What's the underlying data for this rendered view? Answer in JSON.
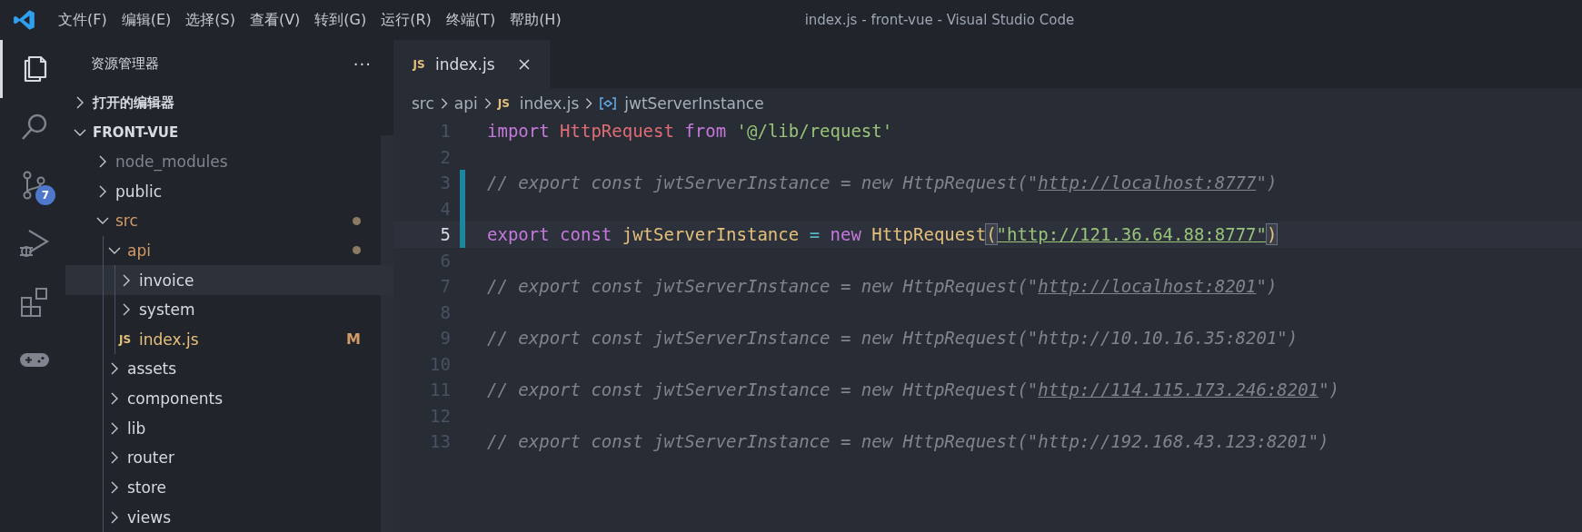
{
  "window": {
    "title": "index.js - front-vue - Visual Studio Code"
  },
  "menu": [
    "文件(F)",
    "编辑(E)",
    "选择(S)",
    "查看(V)",
    "转到(G)",
    "运行(R)",
    "终端(T)",
    "帮助(H)"
  ],
  "activity_bar": [
    {
      "selected": true
    },
    {
      "selected": false
    },
    {
      "selected": false,
      "badge": "7"
    },
    {
      "selected": false
    },
    {
      "selected": false
    },
    {
      "selected": false
    }
  ],
  "sidebar": {
    "title": "资源管理器",
    "more": "···",
    "sections": [
      {
        "label": "打开的编辑器",
        "expanded": false
      },
      {
        "label": "FRONT-VUE",
        "expanded": true
      }
    ],
    "tree": [
      {
        "kind": "folder",
        "label": "node_modules",
        "expanded": false,
        "selected": false,
        "modified": false,
        "ignored": true
      },
      {
        "kind": "folder",
        "label": "public",
        "expanded": false,
        "selected": false,
        "modified": false,
        "ignored": false
      },
      {
        "kind": "folder",
        "label": "src",
        "expanded": true,
        "selected": false,
        "modified": true,
        "ignored": false,
        "children": [
          {
            "kind": "folder",
            "label": "api",
            "expanded": true,
            "selected": false,
            "modified": true,
            "ignored": false,
            "children": [
              {
                "kind": "folder",
                "label": "invoice",
                "expanded": false,
                "selected": true,
                "modified": false,
                "ignored": false
              },
              {
                "kind": "folder",
                "label": "system",
                "expanded": false,
                "selected": false,
                "modified": false,
                "ignored": false
              },
              {
                "kind": "file",
                "icon": "JS",
                "label": "index.js",
                "badge": "M",
                "selected": false,
                "modified": true,
                "ignored": false
              }
            ]
          },
          {
            "kind": "folder",
            "label": "assets",
            "expanded": false,
            "selected": false,
            "modified": false,
            "ignored": false
          },
          {
            "kind": "folder",
            "label": "components",
            "expanded": false,
            "selected": false,
            "modified": false,
            "ignored": false
          },
          {
            "kind": "folder",
            "label": "lib",
            "expanded": false,
            "selected": false,
            "modified": false,
            "ignored": false
          },
          {
            "kind": "folder",
            "label": "router",
            "expanded": false,
            "selected": false,
            "modified": false,
            "ignored": false
          },
          {
            "kind": "folder",
            "label": "store",
            "expanded": false,
            "selected": false,
            "modified": false,
            "ignored": false
          },
          {
            "kind": "folder",
            "label": "views",
            "expanded": false,
            "selected": false,
            "modified": false,
            "ignored": false
          }
        ]
      }
    ]
  },
  "tabs": [
    {
      "icon": "JS",
      "label": "index.js",
      "selected": true
    }
  ],
  "breadcrumbs": [
    {
      "kind": "folder",
      "label": "src"
    },
    {
      "kind": "folder",
      "label": "api"
    },
    {
      "kind": "file",
      "icon": "JS",
      "label": "index.js"
    },
    {
      "kind": "symbol",
      "label": "jwtServerInstance"
    }
  ],
  "lines": [
    {
      "number": "1",
      "current": false,
      "changed": false,
      "tokens": [
        {
          "kind": "keyword",
          "text": "import "
        },
        {
          "kind": "class",
          "text": "HttpRequest "
        },
        {
          "kind": "keyword",
          "text": "from "
        },
        {
          "kind": "string",
          "text": "'@/lib/request'"
        }
      ]
    },
    {
      "number": "2",
      "current": false,
      "changed": false
    },
    {
      "number": "3",
      "current": false,
      "changed": true,
      "tokens": [
        {
          "kind": "comment",
          "text": "// export const jwtServerInstance = new HttpRequest(\""
        },
        {
          "kind": "comment-link",
          "text": "http://localhost:8777"
        },
        {
          "kind": "comment",
          "text": "\")"
        }
      ]
    },
    {
      "number": "4",
      "current": false,
      "changed": true
    },
    {
      "number": "5",
      "current": true,
      "changed": true,
      "tokens": [
        {
          "kind": "keyword",
          "text": "export const "
        },
        {
          "kind": "variable",
          "text": "jwtServerInstance "
        },
        {
          "kind": "operator",
          "text": "= "
        },
        {
          "kind": "keyword",
          "text": "new "
        },
        {
          "kind": "variable",
          "text": "HttpRequest"
        },
        {
          "kind": "bracket-match",
          "text": "("
        },
        {
          "kind": "string-link",
          "text": "\"http://121.36.64.88:8777\""
        },
        {
          "kind": "bracket-match",
          "text": ")"
        }
      ]
    },
    {
      "number": "6",
      "current": false,
      "changed": false
    },
    {
      "number": "7",
      "current": false,
      "changed": false,
      "tokens": [
        {
          "kind": "comment",
          "text": "// export const jwtServerInstance = new HttpRequest(\""
        },
        {
          "kind": "comment-link",
          "text": "http://localhost:8201"
        },
        {
          "kind": "comment",
          "text": "\")"
        }
      ]
    },
    {
      "number": "8",
      "current": false,
      "changed": false
    },
    {
      "number": "9",
      "current": false,
      "changed": false,
      "tokens": [
        {
          "kind": "comment",
          "text": "// export const jwtServerInstance = new HttpRequest(\"http://10.10.16.35:8201\")"
        }
      ]
    },
    {
      "number": "10",
      "current": false,
      "changed": false
    },
    {
      "number": "11",
      "current": false,
      "changed": false,
      "tokens": [
        {
          "kind": "comment",
          "text": "// export const jwtServerInstance = new HttpRequest(\""
        },
        {
          "kind": "comment-link",
          "text": "http://114.115.173.246:8201"
        },
        {
          "kind": "comment",
          "text": "\")"
        }
      ]
    },
    {
      "number": "12",
      "current": false,
      "changed": false
    },
    {
      "number": "13",
      "current": false,
      "changed": false,
      "tokens": [
        {
          "kind": "comment",
          "text": "// export const jwtServerInstance = new HttpRequest(\"http://192.168.43.123:8201\")"
        }
      ]
    }
  ]
}
